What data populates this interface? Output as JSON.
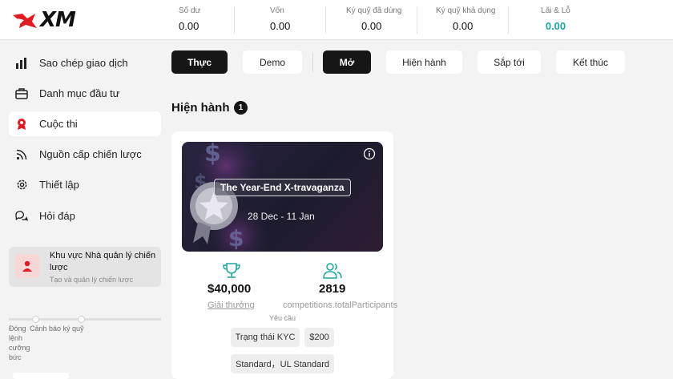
{
  "brand": {
    "logo_text": "XM",
    "accent": "#e11b22"
  },
  "header": {
    "stats": [
      {
        "label": "Số dư",
        "value": "0.00"
      },
      {
        "label": "Vốn",
        "value": "0.00"
      },
      {
        "label": "Ký quỹ đã dùng",
        "value": "0.00"
      },
      {
        "label": "Ký quỹ khả dụng",
        "value": "0.00"
      },
      {
        "label": "Lãi & Lỗ",
        "value": "0.00",
        "color": "#1fa6a0"
      }
    ]
  },
  "sidebar": {
    "items": [
      {
        "label": "Sao chép giao dịch",
        "icon": "bar-chart-icon"
      },
      {
        "label": "Danh mục đầu tư",
        "icon": "briefcase-icon"
      },
      {
        "label": "Cuộc thi",
        "icon": "award-icon",
        "active": true
      },
      {
        "label": "Nguồn cấp chiến lược",
        "icon": "feed-icon"
      },
      {
        "label": "Thiết lập",
        "icon": "gear-icon"
      },
      {
        "label": "Hỏi đáp",
        "icon": "chat-icon"
      }
    ],
    "manager": {
      "title": "Khu vực Nhà quản lý chiến lược",
      "subtitle": "Tạo và quản lý chiến lược"
    },
    "slider": {
      "left_label": "Đóng lệnh cưỡng bức",
      "right_label": "Cảnh báo ký quỹ"
    }
  },
  "filters": {
    "account": [
      "Thực",
      "Demo"
    ],
    "status": [
      "Mở",
      "Hiện hành",
      "Sắp tới",
      "Kết thúc"
    ]
  },
  "section": {
    "title": "Hiện hành",
    "count": "1"
  },
  "competition": {
    "title": "The Year-End X-travaganza",
    "dates": "28 Dec - 11 Jan",
    "prize": "$40,000",
    "prize_label": "Giải thưởng",
    "participants": "2819",
    "participants_label": "competitions.totalParticipants",
    "requirements_label": "Yêu cầu",
    "requirements": [
      "Trạng thái KYC",
      "$200",
      "Standard，UL Standard"
    ]
  }
}
